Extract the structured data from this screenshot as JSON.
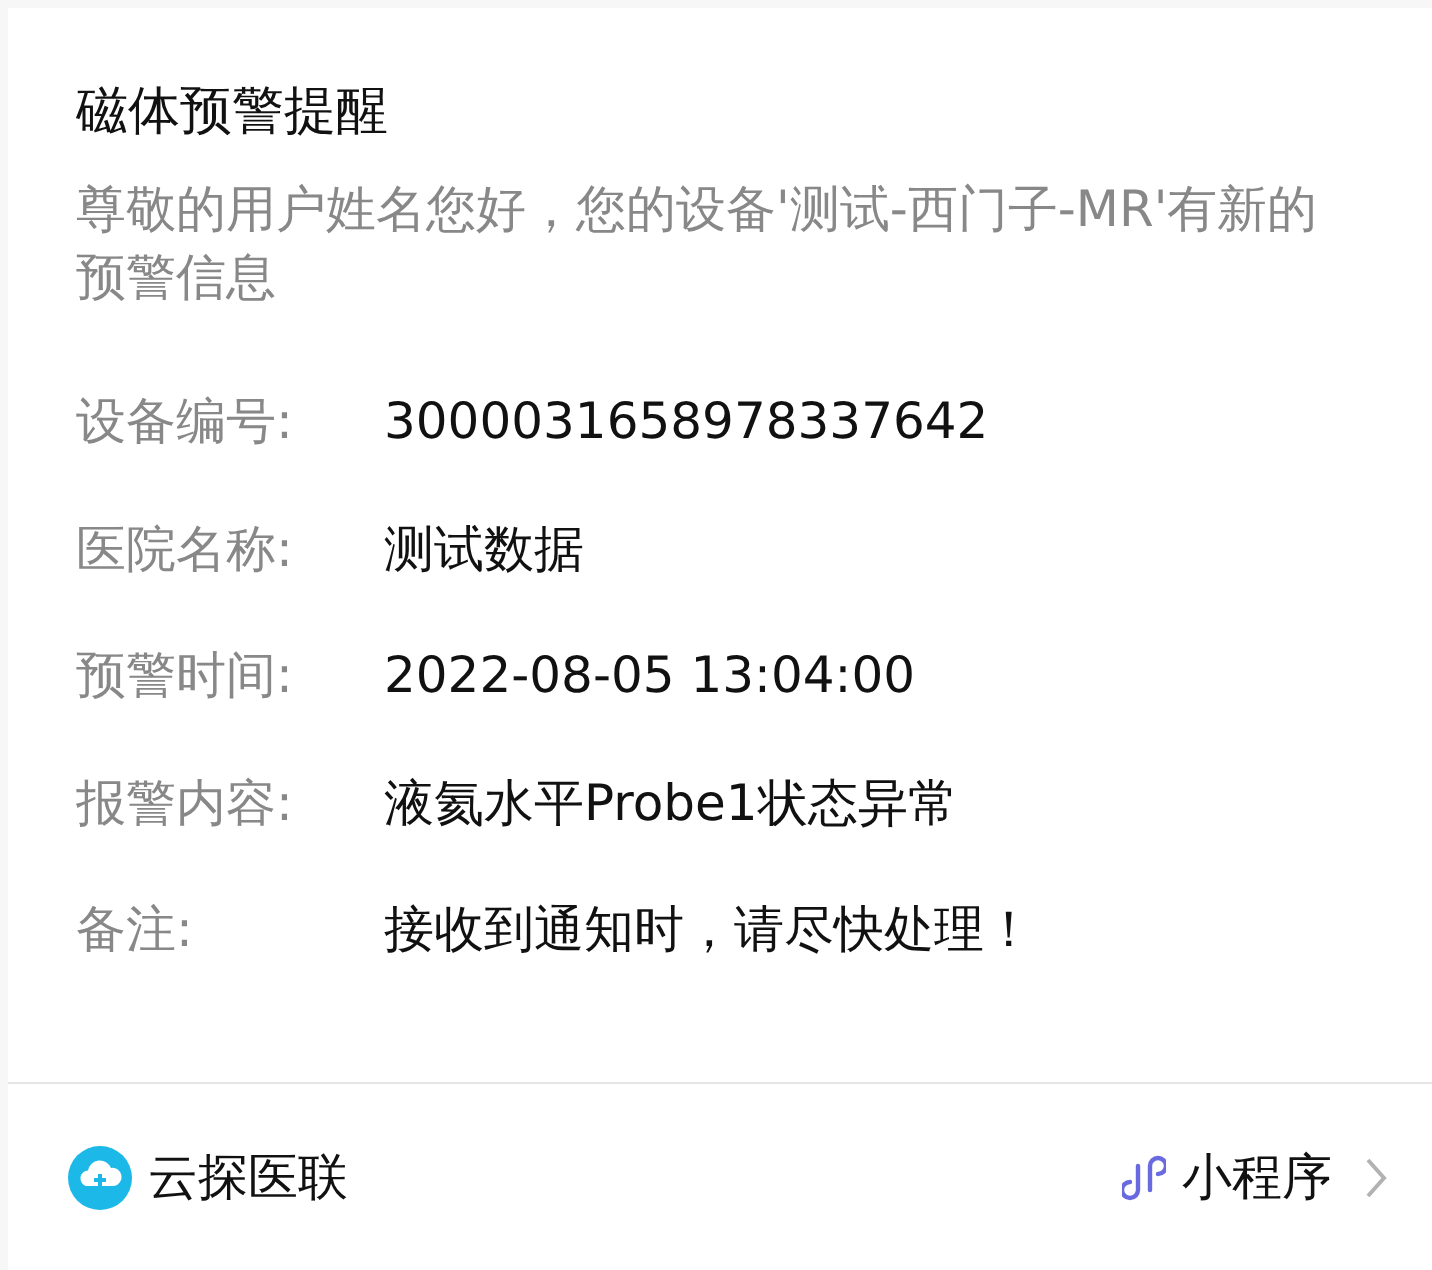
{
  "title": "磁体预警提醒",
  "subtitle": "尊敬的用户姓名您好，您的设备'测试-西门子-MR'有新的预警信息",
  "fields": [
    {
      "label": "设备编号:",
      "value": "3000031658978337642"
    },
    {
      "label": "医院名称:",
      "value": "测试数据"
    },
    {
      "label": "预警时间:",
      "value": "2022-08-05 13:04:00"
    },
    {
      "label": "报警内容:",
      "value": "液氦水平Probe1状态异常"
    },
    {
      "label": "备注:",
      "value": "接收到通知时，请尽快处理！"
    }
  ],
  "footer": {
    "account": "云探医联",
    "link": "小程序"
  }
}
